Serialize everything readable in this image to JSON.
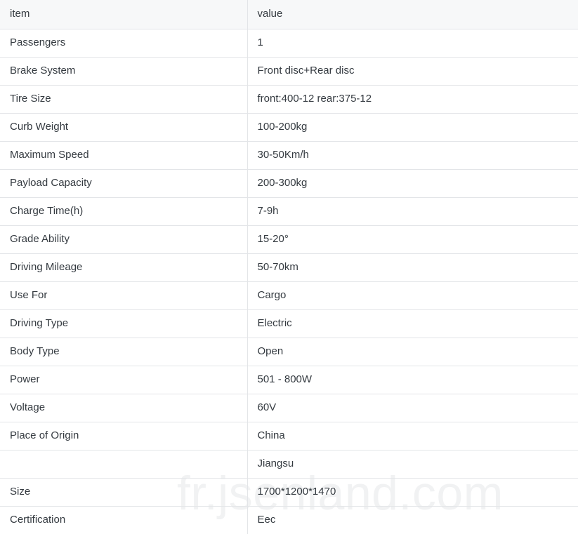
{
  "table": {
    "columns": [
      {
        "key": "item",
        "label": "item"
      },
      {
        "key": "value",
        "label": "value"
      }
    ],
    "rows": [
      {
        "item": "Passengers",
        "value": "1"
      },
      {
        "item": "Brake System",
        "value": "Front disc+Rear disc"
      },
      {
        "item": "Tire Size",
        "value": "front:400-12 rear:375-12"
      },
      {
        "item": "Curb Weight",
        "value": "100-200kg"
      },
      {
        "item": "Maximum Speed",
        "value": "30-50Km/h"
      },
      {
        "item": "Payload Capacity",
        "value": "200-300kg"
      },
      {
        "item": "Charge Time(h)",
        "value": "7-9h"
      },
      {
        "item": "Grade Ability",
        "value": "15-20°"
      },
      {
        "item": "Driving Mileage",
        "value": "50-70km"
      },
      {
        "item": "Use For",
        "value": "Cargo"
      },
      {
        "item": "Driving Type",
        "value": "Electric"
      },
      {
        "item": "Body Type",
        "value": "Open"
      },
      {
        "item": "Power",
        "value": "501 - 800W"
      },
      {
        "item": "Voltage",
        "value": "60V"
      },
      {
        "item": "Place of Origin",
        "value": "China"
      },
      {
        "item": "",
        "value": "Jiangsu"
      },
      {
        "item": "Size",
        "value": "1700*1200*1470"
      },
      {
        "item": "Certification",
        "value": "Eec"
      }
    ]
  },
  "watermark": {
    "text": "fr.jsenland.com",
    "color": "#f1f2f3"
  },
  "style": {
    "header_background": "#f7f8f9",
    "border_color": "#e3e5e8",
    "text_color": "#343a40",
    "page_background": "#ffffff"
  }
}
